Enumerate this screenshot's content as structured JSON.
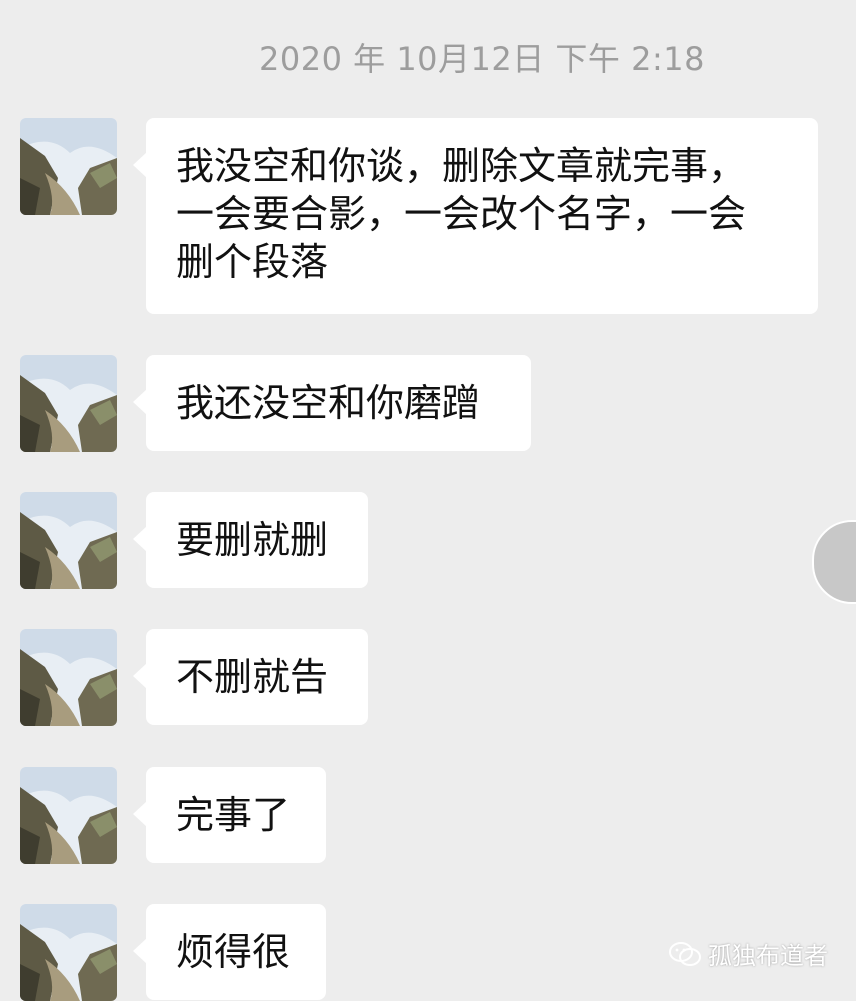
{
  "chat": {
    "timestamp": "2020 年 10月12日 下午 2:18",
    "messages": [
      {
        "sender": "contact",
        "text": "我没空和你谈，删除文章就完事，\n一会要合影，一会改个名字，一会\n删个段落"
      },
      {
        "sender": "contact",
        "text": "我还没空和你磨蹭"
      },
      {
        "sender": "contact",
        "text": "要删就删"
      },
      {
        "sender": "contact",
        "text": "不删就告"
      },
      {
        "sender": "contact",
        "text": "完事了"
      },
      {
        "sender": "contact",
        "text": "烦得很"
      }
    ]
  },
  "watermark": {
    "icon": "wechat-icon",
    "text": "孤独布道者"
  },
  "colors": {
    "background": "#ededed",
    "bubble": "#ffffff",
    "timestamp": "#9d9d9d"
  }
}
